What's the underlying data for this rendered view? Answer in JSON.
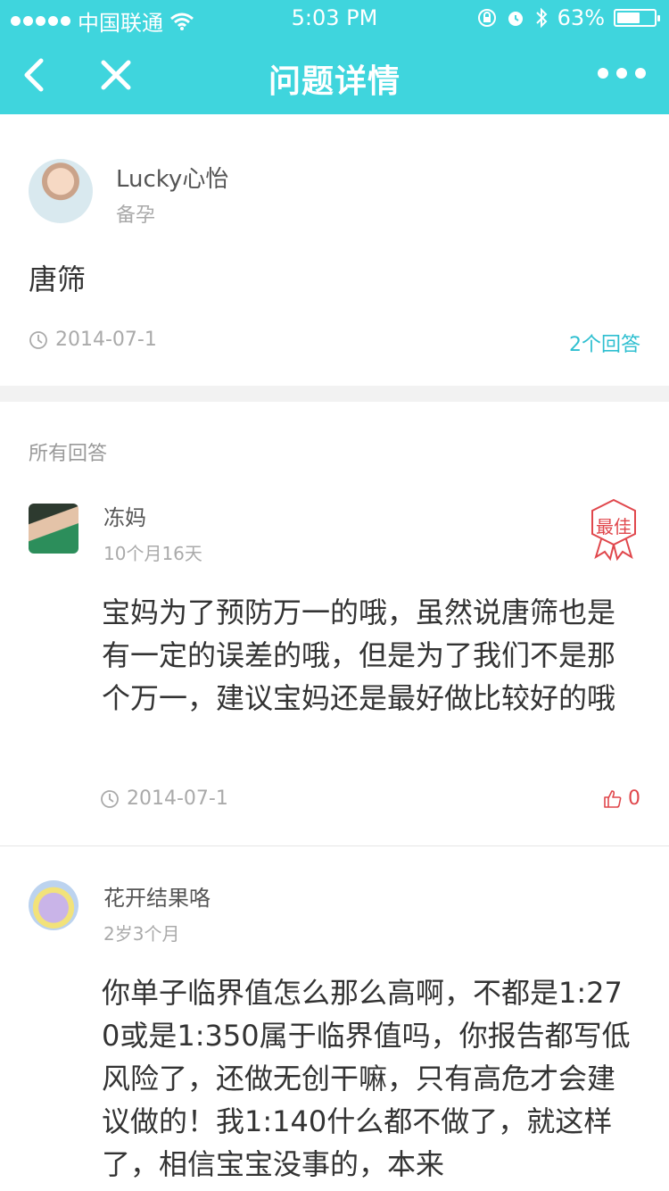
{
  "status_bar": {
    "carrier": "中国联通",
    "time": "5:03 PM",
    "battery_text": "63%",
    "battery_level": 0.63
  },
  "nav": {
    "title": "问题详情"
  },
  "question": {
    "user_name": "Lucky心怡",
    "user_status": "备孕",
    "text": "唐筛",
    "date": "2014-07-1",
    "answer_count": "2个回答"
  },
  "answers_section": {
    "title": "所有回答"
  },
  "answers": [
    {
      "user_name": "冻妈",
      "child_age": "10个月16天",
      "badge": "最佳",
      "text": "宝妈为了预防万一的哦，虽然说唐筛也是有一定的误差的哦，但是为了我们不是那个万一，建议宝妈还是最好做比较好的哦",
      "date": "2014-07-1",
      "likes": "0"
    },
    {
      "user_name": "花开结果咯",
      "child_age": "2岁3个月",
      "text": "你单子临界值怎么那么高啊，不都是1:270或是1:350属于临界值吗，你报告都写低风险了，还做无创干嘛，只有高危才会建议做的！我1:140什么都不做了，就这样了，相信宝宝没事的，本来"
    }
  ],
  "colors": {
    "nav_bg": "#3fd5dd",
    "accent": "#2ebfd0",
    "like_red": "#e0474c"
  }
}
